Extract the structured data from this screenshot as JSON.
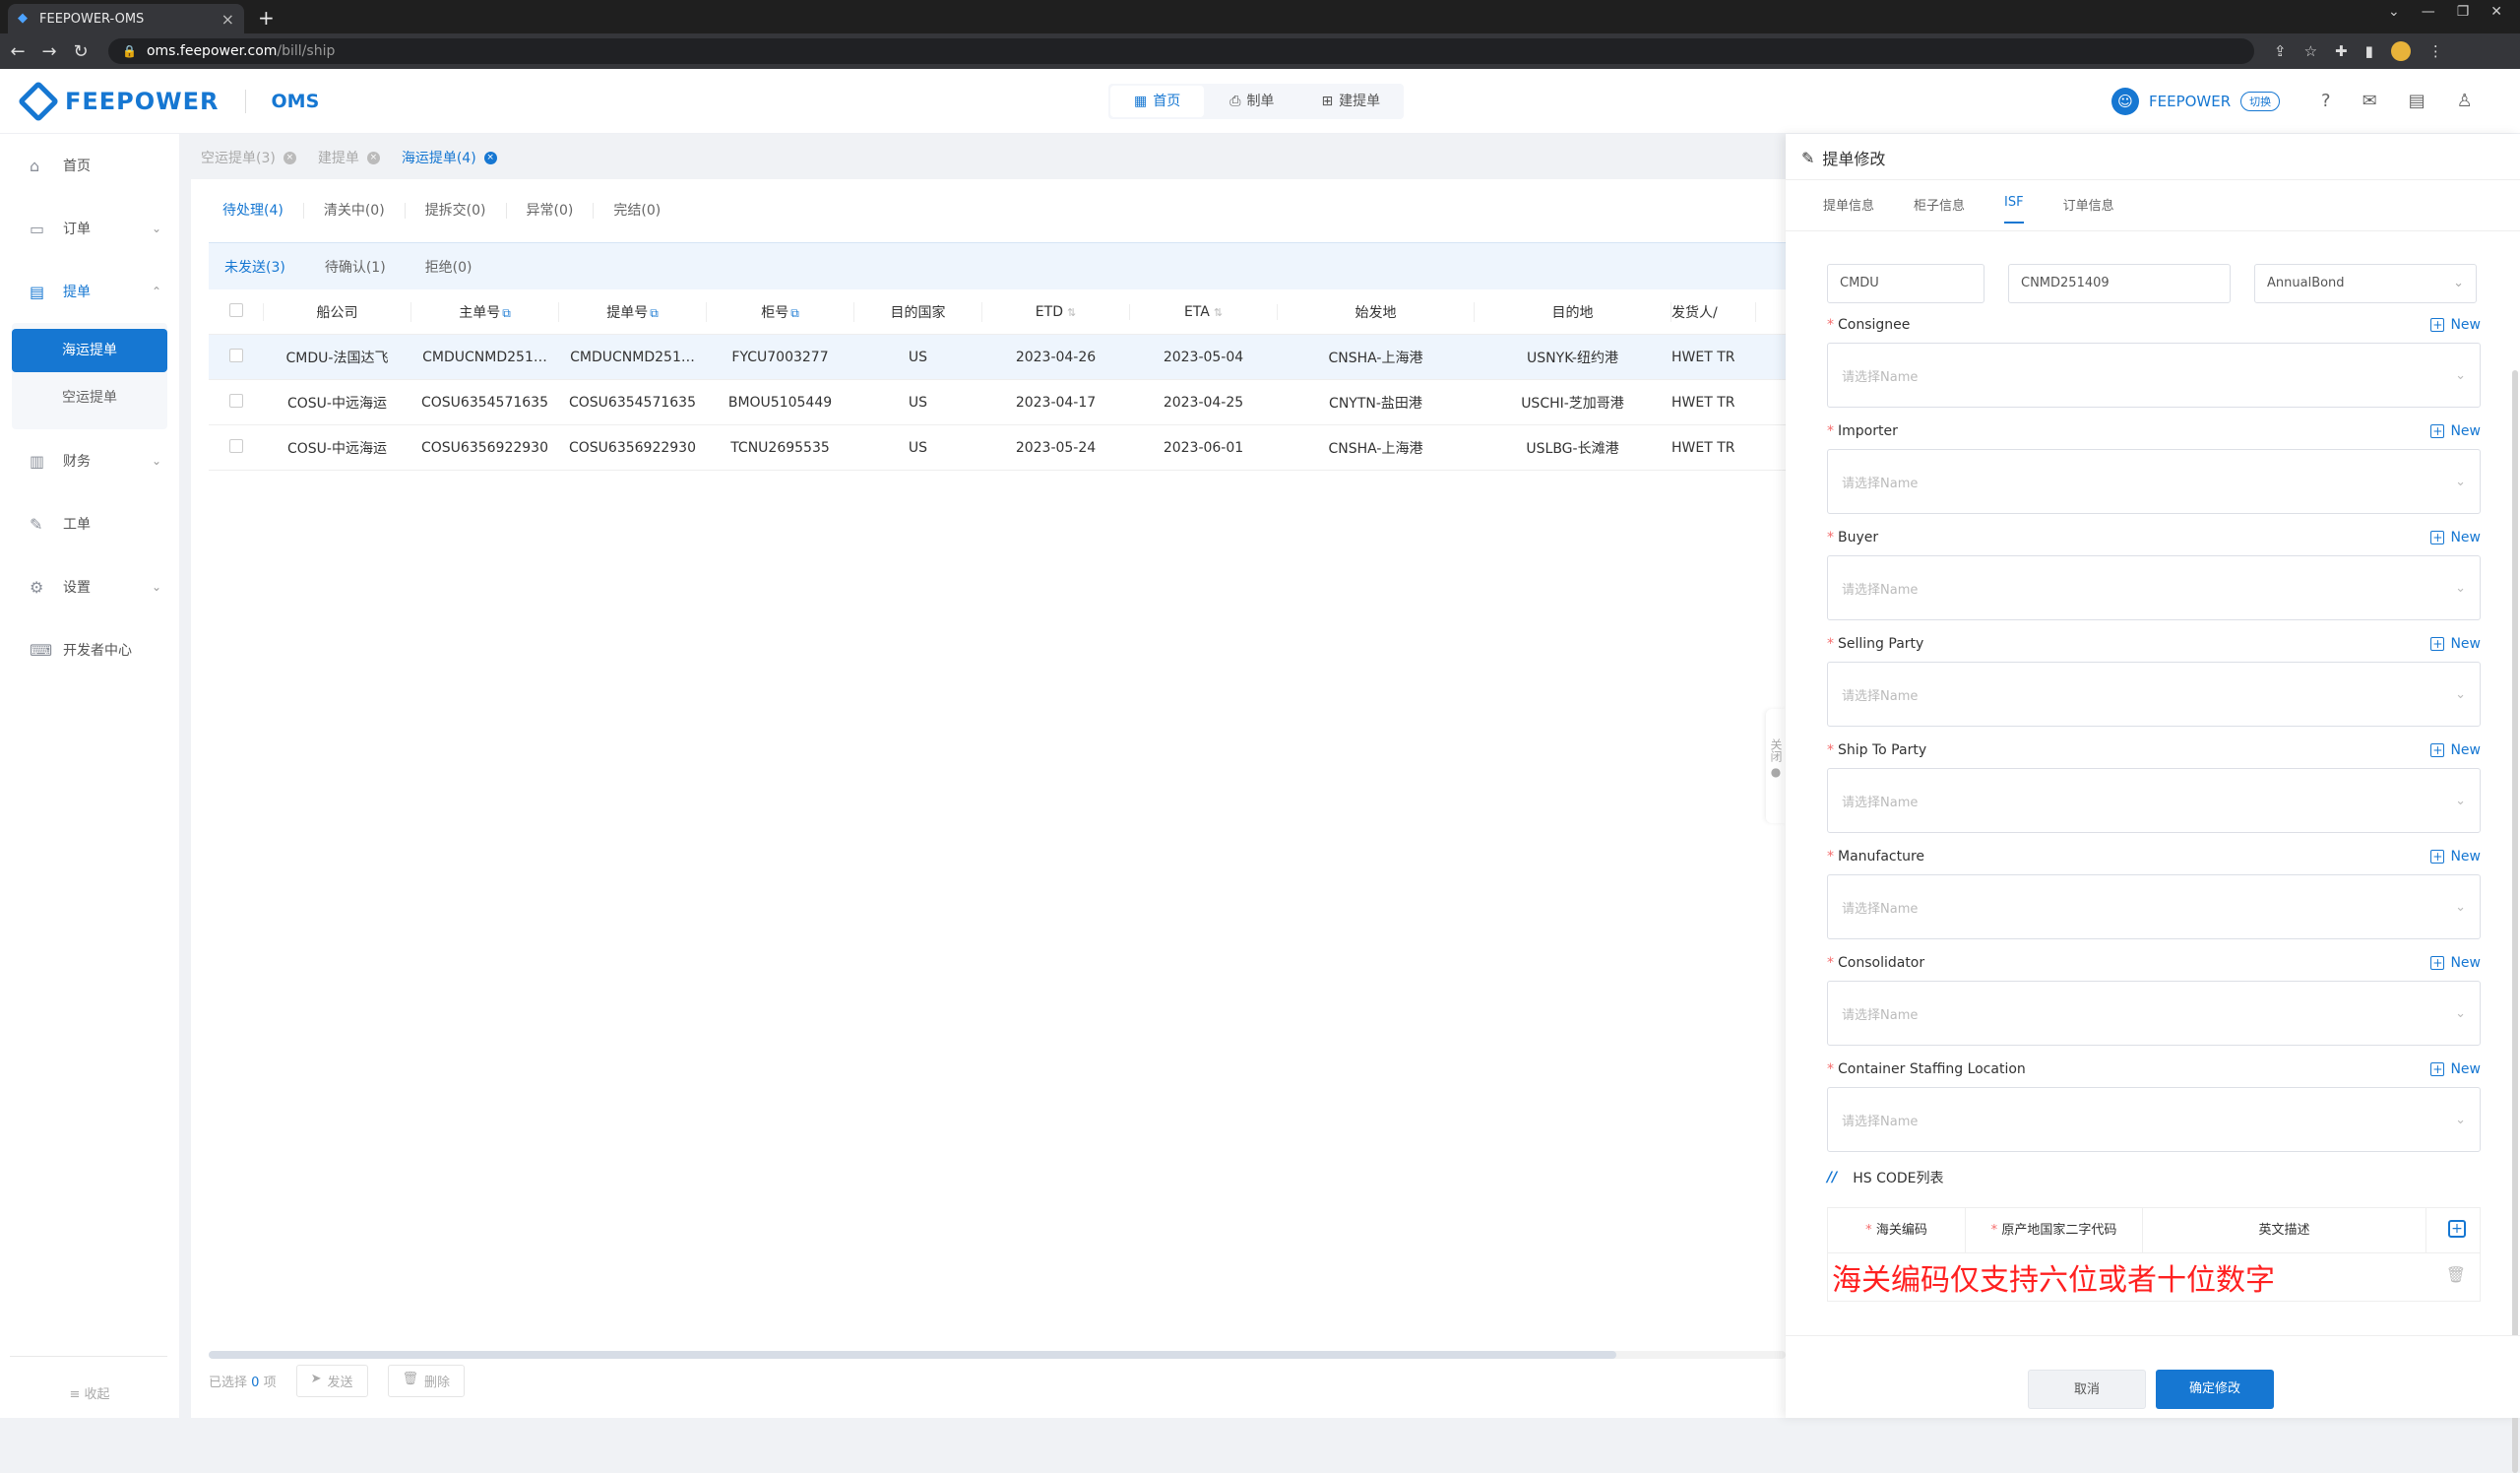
{
  "browser": {
    "tab_title": "FEEPOWER-OMS",
    "url_host": "oms.feepower.com",
    "url_path": "/bill/ship"
  },
  "header": {
    "brand": "FEEPOWER",
    "product": "OMS",
    "nav": [
      "首页",
      "制单",
      "建提单"
    ],
    "user": "FEEPOWER",
    "switch": "切换"
  },
  "sidebar": {
    "items": [
      "首页",
      "订单",
      "提单",
      "财务",
      "工单",
      "设置",
      "开发者中心"
    ],
    "sub": [
      "海运提单",
      "空运提单"
    ],
    "collapse": "收起"
  },
  "breadcrumbs": [
    "空运提单(3)",
    "建提单",
    "海运提单(4)"
  ],
  "status_tabs": [
    "待处理(4)",
    "清关中(0)",
    "提拆交(0)",
    "异常(0)",
    "完结(0)"
  ],
  "sub_tabs": [
    "未发送(3)",
    "待确认(1)",
    "拒绝(0)"
  ],
  "table": {
    "headers": [
      "船公司",
      "主单号",
      "提单号",
      "柜号",
      "目的国家",
      "ETD",
      "ETA",
      "始发地",
      "目的地",
      "发货人/"
    ],
    "rows": [
      [
        "CMDU-法国达飞",
        "CMDUCNMD251…",
        "CMDUCNMD251…",
        "FYCU7003277",
        "US",
        "2023-04-26",
        "2023-05-04",
        "CNSHA-上海港",
        "USNYK-纽约港",
        "HWET TR"
      ],
      [
        "COSU-中远海运",
        "COSU6354571635",
        "COSU6354571635",
        "BMOU5105449",
        "US",
        "2023-04-17",
        "2023-04-25",
        "CNYTN-盐田港",
        "USCHI-芝加哥港",
        "HWET TR"
      ],
      [
        "COSU-中远海运",
        "COSU6356922930",
        "COSU6356922930",
        "TCNU2695535",
        "US",
        "2023-05-24",
        "2023-06-01",
        "CNSHA-上海港",
        "USLBG-长滩港",
        "HWET TR"
      ]
    ]
  },
  "footer": {
    "selected_prefix": "已选择",
    "selected_count": "0",
    "selected_suffix": "项",
    "send": "发送",
    "delete": "删除"
  },
  "drawer": {
    "title": "提单修改",
    "tabs": [
      "提单信息",
      "柜子信息",
      "ISF",
      "订单信息"
    ],
    "collapse_label": "关闭",
    "top_inputs": [
      "CMDU",
      "CNMD251409",
      "AnnualBond"
    ],
    "new_label": "New",
    "placeholder": "请选择Name",
    "fields": [
      "Consignee",
      "Importer",
      "Buyer",
      "Selling Party",
      "Ship To Party",
      "Manufacture",
      "Consolidator",
      "Container Staffing Location"
    ],
    "hs_title": "HS CODE列表",
    "hs_headers": [
      "海关编码",
      "原产地国家二字代码",
      "英文描述"
    ],
    "hs_error": "海关编码仅支持六位或者十位数字",
    "cancel": "取消",
    "confirm": "确定修改"
  },
  "colors": {
    "accent": "#1677d2",
    "error": "#ff2020"
  }
}
